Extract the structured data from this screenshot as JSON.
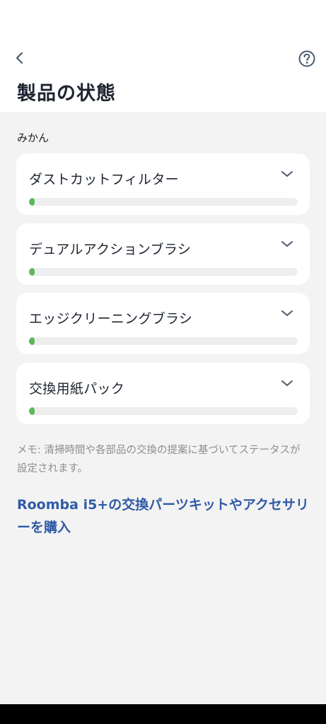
{
  "header": {
    "title": "製品の状態",
    "back_icon": "chevron-left-icon",
    "help_icon": "question-circle-icon"
  },
  "device": {
    "name": "みかん"
  },
  "parts": [
    {
      "label": "ダストカットフィルター",
      "level": 0.02
    },
    {
      "label": "デュアルアクションブラシ",
      "level": 0.02
    },
    {
      "label": "エッジクリーニングブラシ",
      "level": 0.02
    },
    {
      "label": "交換用紙パック",
      "level": 0.02
    }
  ],
  "note": "メモ: 清掃時間や各部品の交換の提案に基づいてステータスが設定されます。",
  "purchase_link": "Roomba i5+の交換パーツキットやアクセサリーを購入",
  "colors": {
    "accent": "#2f5ba6",
    "progress": "#5cb85c",
    "background": "#f3f3f3",
    "card": "#ffffff"
  }
}
